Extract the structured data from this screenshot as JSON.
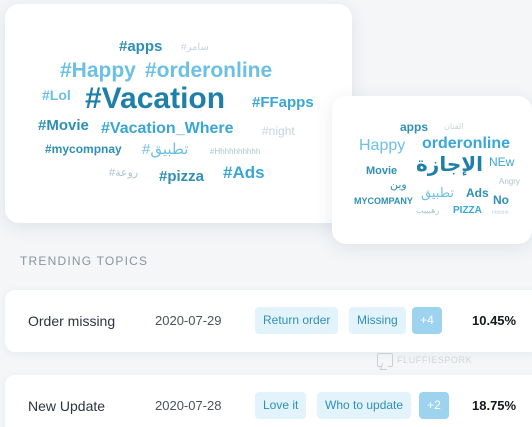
{
  "word_cloud_main": {
    "words": [
      {
        "text": "#apps",
        "color": "#2f8fb5"
      },
      {
        "text": "#سامر",
        "color": "#c4d5df"
      },
      {
        "text": "#Happy",
        "color": "#6cc0e3"
      },
      {
        "text": "#orderonline",
        "color": "#6cc0e3"
      },
      {
        "text": "#Lol",
        "color": "#6cc0e3"
      },
      {
        "text": "#Vacation",
        "color": "#1f7fa8"
      },
      {
        "text": "#FFapps",
        "color": "#3aa6d6"
      },
      {
        "text": "#Movie",
        "color": "#2f8fb5"
      },
      {
        "text": "#Vacation_Where",
        "color": "#3aa6d6"
      },
      {
        "text": "#night",
        "color": "#c4d5df"
      },
      {
        "text": "#mycompnay",
        "color": "#2f8fb5"
      },
      {
        "text": "#تطبيق",
        "color": "#6cc0e3"
      },
      {
        "text": "#Hhhhhhhhhh",
        "color": "#a9c4d3"
      },
      {
        "text": "#روعة",
        "color": "#a9c4d3"
      },
      {
        "text": "#pizza",
        "color": "#2f8fb5"
      },
      {
        "text": "#Ads",
        "color": "#3aa6d6"
      }
    ]
  },
  "word_cloud_secondary": {
    "words": [
      {
        "text": "apps",
        "color": "#2f8fb5"
      },
      {
        "text": "الفنان",
        "color": "#c4d5df"
      },
      {
        "text": "Happy",
        "color": "#6cc0e3"
      },
      {
        "text": "orderonline",
        "color": "#3aa6d6"
      },
      {
        "text": "الإجازة",
        "color": "#1f7fa8"
      },
      {
        "text": "NEw",
        "color": "#3aa6d6"
      },
      {
        "text": "Movie",
        "color": "#2f8fb5"
      },
      {
        "text": "Angry",
        "color": "#a9c4d3"
      },
      {
        "text": "وين",
        "color": "#2f8fb5"
      },
      {
        "text": "تطبيق",
        "color": "#6cc0e3"
      },
      {
        "text": "Ads",
        "color": "#2f8fb5"
      },
      {
        "text": "MYCOMPANY",
        "color": "#2f8fb5"
      },
      {
        "text": "No",
        "color": "#2f8fb5"
      },
      {
        "text": "PIZZA",
        "color": "#3aa6d6"
      },
      {
        "text": "رهيييب",
        "color": "#a9c4d3"
      },
      {
        "text": "hhhhhh",
        "color": "#c4d5df"
      }
    ]
  },
  "trending": {
    "title": "TRENDING TOPICS",
    "rows": [
      {
        "name": "Order missing",
        "date": "2020-07-29",
        "tags": [
          "Return order",
          "Missing"
        ],
        "more": "+4",
        "percent": "10.45%"
      },
      {
        "name": "New Update",
        "date": "2020-07-28",
        "tags": [
          "Love it",
          "Who to update"
        ],
        "more": "+2",
        "percent": "18.75%"
      }
    ]
  },
  "watermark": {
    "text": "FLUFFIESPORK"
  }
}
